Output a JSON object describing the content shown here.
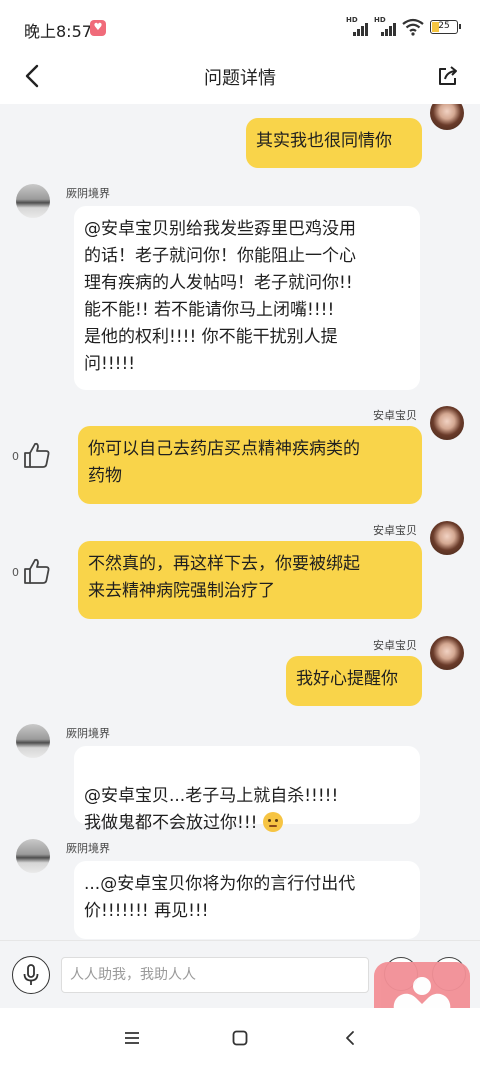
{
  "status_bar": {
    "time": "晚上8:57",
    "signal1_label": "HD",
    "signal2_label": "HD",
    "battery": "25"
  },
  "header": {
    "title": "问题详情",
    "back_icon": "chevron-left-icon",
    "share_icon": "share-icon"
  },
  "messages": [
    {
      "side": "right",
      "sender": "",
      "text": "其实我也很同情你"
    },
    {
      "side": "left",
      "sender": "厥阴境界",
      "text": "@安卓宝贝别给我发些孬里巴鸡没用\n的话！老子就问你！你能阻止一个心\n理有疾病的人发帖吗！老子就问你!!\n能不能!! 若不能请你马上闭嘴!!!!\n是他的权利!!!! 你不能干扰别人提\n问!!!!!"
    },
    {
      "side": "right",
      "sender": "安卓宝贝",
      "likes": "0",
      "text": "你可以自己去药店买点精神疾病类的\n药物"
    },
    {
      "side": "right",
      "sender": "安卓宝贝",
      "likes": "0",
      "text": "不然真的，再这样下去，你要被绑起\n来去精神病院强制治疗了"
    },
    {
      "side": "right",
      "sender": "安卓宝贝",
      "text": "我好心提醒你"
    },
    {
      "side": "left",
      "sender": "厥阴境界",
      "text": "@安卓宝贝...老子马上就自杀!!!!!\n我做鬼都不会放过你!!! "
    },
    {
      "side": "left",
      "sender": "厥阴境界",
      "text": "...@安卓宝贝你将为你的言行付出代\n价!!!!!!! 再见!!!"
    }
  ],
  "input": {
    "placeholder": "人人助我，我助人人"
  },
  "colors": {
    "bubble_mine": "#f9d44a",
    "bubble_other": "#ffffff",
    "chat_bg": "#f3f4f6",
    "heart_badge": "#f28f96"
  }
}
